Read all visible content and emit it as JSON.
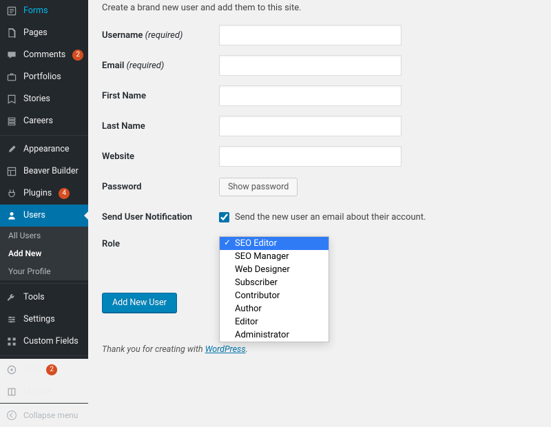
{
  "sidebar": {
    "items": [
      {
        "label": "Forms",
        "icon": "form",
        "badge": null
      },
      {
        "label": "Pages",
        "icon": "page",
        "badge": null
      },
      {
        "label": "Comments",
        "icon": "comment",
        "badge": "2"
      },
      {
        "label": "Portfolios",
        "icon": "portfolio",
        "badge": null
      },
      {
        "label": "Stories",
        "icon": "story",
        "badge": null
      },
      {
        "label": "Careers",
        "icon": "career",
        "badge": null
      },
      {
        "label": "Appearance",
        "icon": "brush",
        "badge": null,
        "sepBefore": true
      },
      {
        "label": "Beaver Builder",
        "icon": "layout",
        "badge": null
      },
      {
        "label": "Plugins",
        "icon": "plug",
        "badge": "4"
      },
      {
        "label": "Users",
        "icon": "user",
        "badge": null,
        "active": true,
        "submenu": [
          {
            "label": "All Users",
            "current": false
          },
          {
            "label": "Add New",
            "current": true
          },
          {
            "label": "Your Profile",
            "current": false
          }
        ]
      },
      {
        "label": "Tools",
        "icon": "wrench",
        "badge": null
      },
      {
        "label": "Settings",
        "icon": "sliders",
        "badge": null
      },
      {
        "label": "Custom Fields",
        "icon": "grid",
        "badge": null
      },
      {
        "label": "SEO",
        "icon": "seo",
        "badge": "2",
        "sepBefore": true
      },
      {
        "label": "Manual",
        "icon": "book",
        "badge": null
      }
    ],
    "collapse_label": "Collapse menu"
  },
  "main": {
    "intro": "Create a brand new user and add them to this site.",
    "fields": {
      "username_label": "Username",
      "required_suffix": "(required)",
      "email_label": "Email",
      "firstname_label": "First Name",
      "lastname_label": "Last Name",
      "website_label": "Website",
      "password_label": "Password",
      "show_password": "Show password",
      "notify_label": "Send User Notification",
      "notify_text": "Send the new user an email about their account.",
      "notify_checked": true,
      "role_label": "Role"
    },
    "role_options": [
      "SEO Editor",
      "SEO Manager",
      "Web Designer",
      "Subscriber",
      "Contributor",
      "Author",
      "Editor",
      "Administrator"
    ],
    "role_selected_index": 0,
    "submit_label": "Add New User",
    "footer_pre": "Thank you for creating with ",
    "footer_link": "WordPress",
    "footer_post": "."
  }
}
